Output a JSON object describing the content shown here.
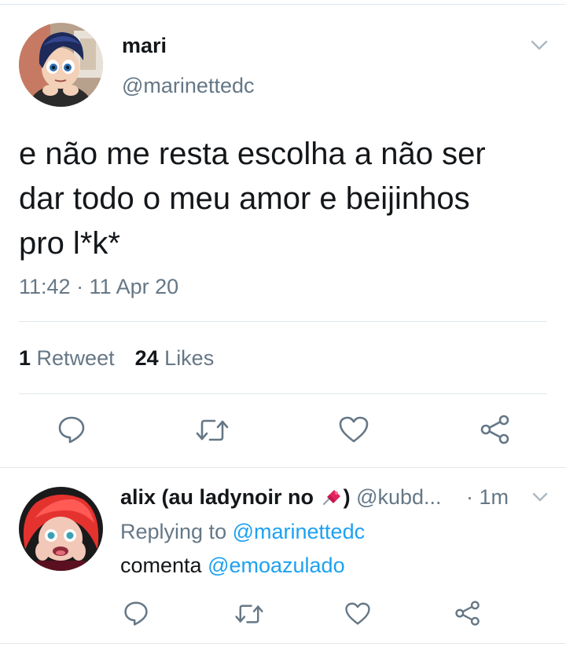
{
  "tweet": {
    "display_name": "mari",
    "handle": "@marinettedc",
    "text": "e não me resta escolha a não ser\ndar todo o meu amor e beijinhos\npro l*k*",
    "timestamp": "11:42 · 11 Apr 20",
    "retweet_count": "1",
    "retweet_label": "Retweet",
    "like_count": "24",
    "like_label": "Likes"
  },
  "reply": {
    "display_name": "alix (au ladynoir no",
    "name_suffix": ")",
    "handle": "@kubd...",
    "time": "· 1m",
    "replying_prefix": "Replying to",
    "replying_handle": "@marinettedc",
    "text_prefix": "comenta",
    "mention": "@emoazulado"
  },
  "icons": {
    "reply": "reply-icon",
    "retweet": "retweet-icon",
    "like": "heart-icon",
    "share": "share-icon",
    "menu": "chevron-down-icon",
    "pin": "pushpin-emoji"
  },
  "colors": {
    "text": "#14171a",
    "secondary": "#657786",
    "link": "#1da1f2",
    "divider": "#e1e8ed"
  }
}
